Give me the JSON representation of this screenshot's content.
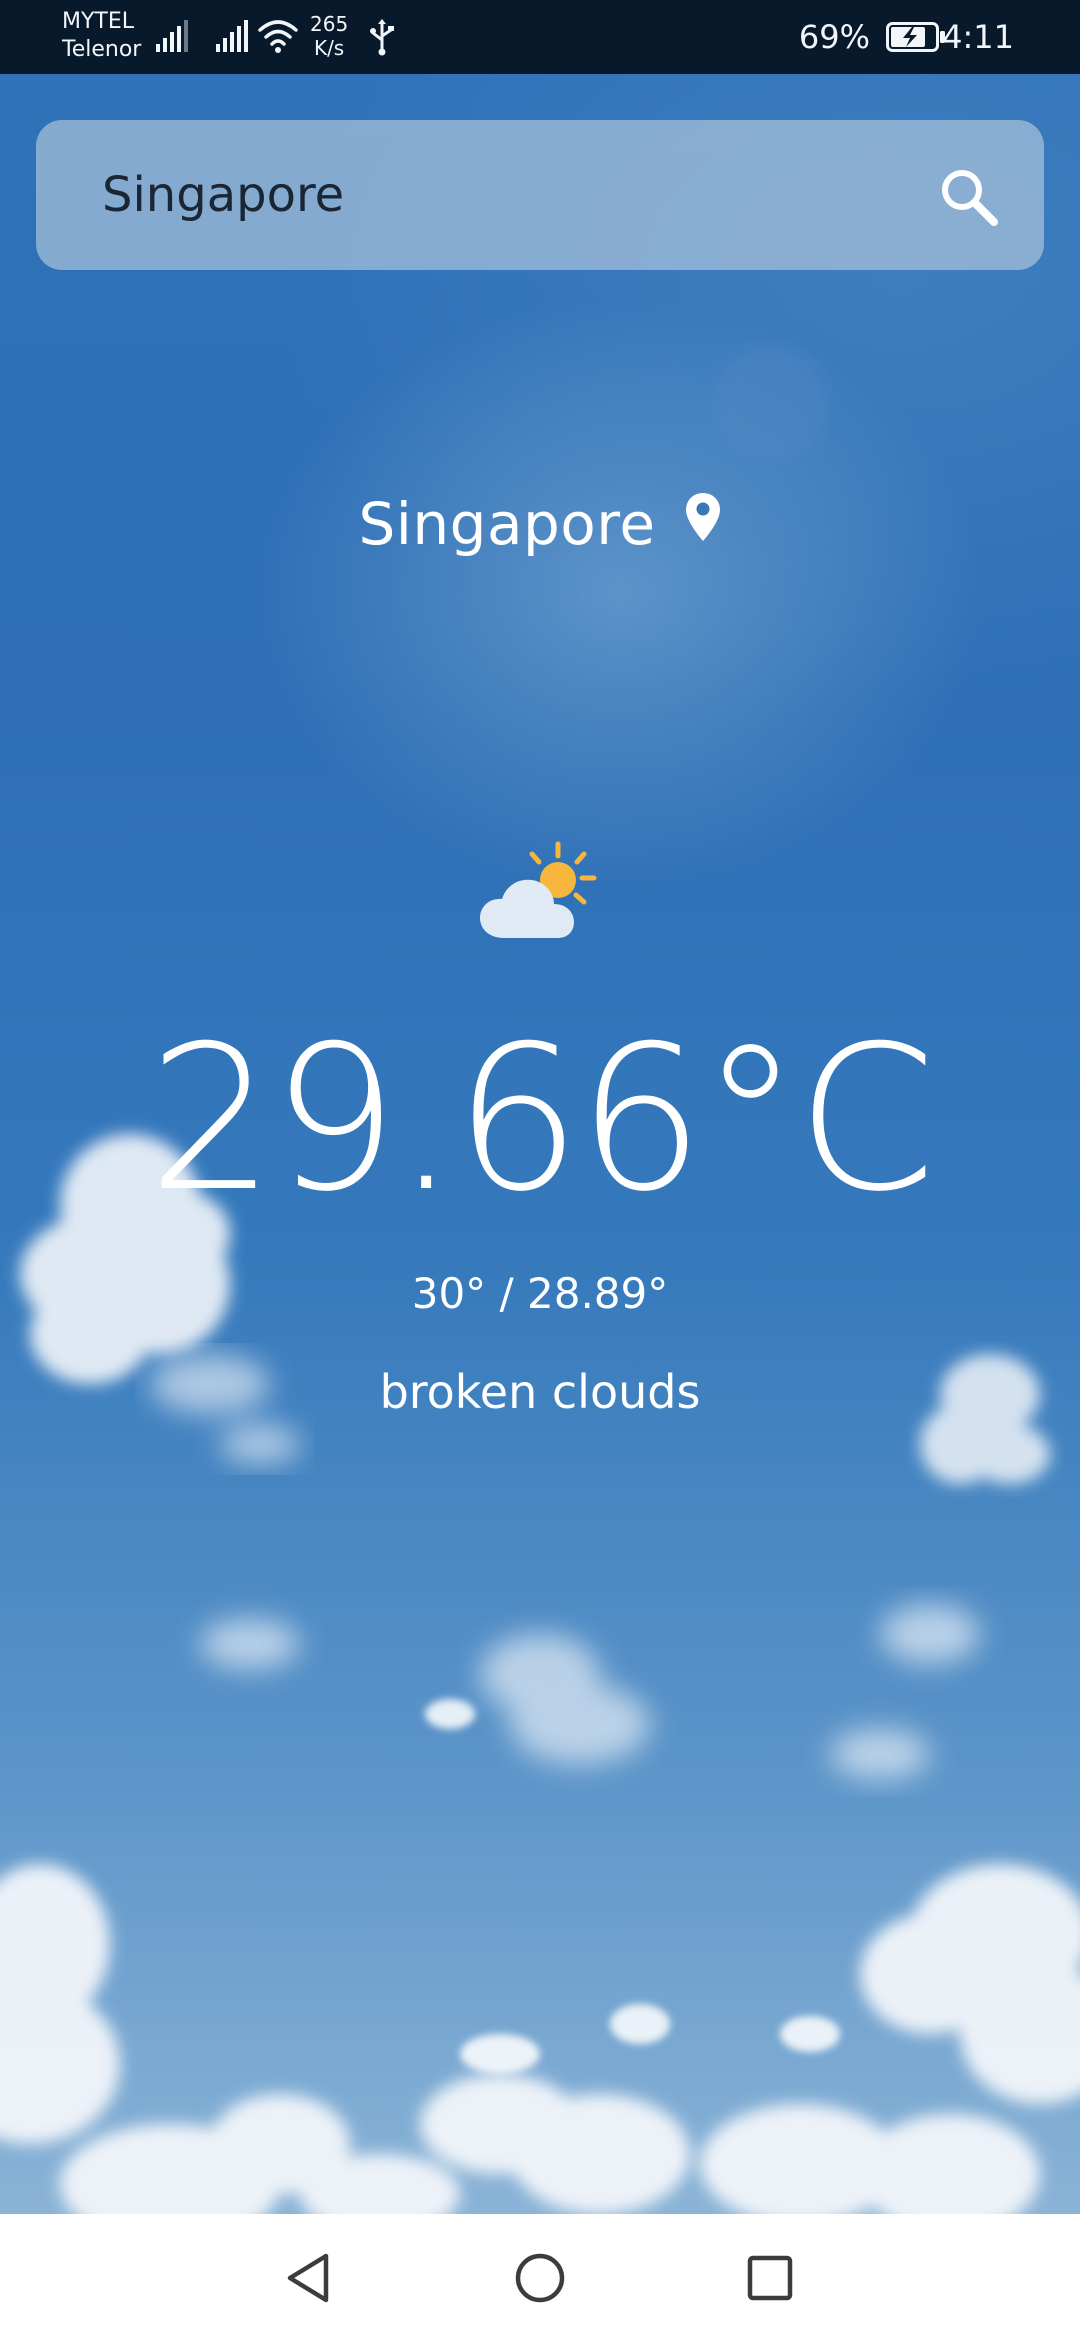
{
  "status_bar": {
    "carrier_1": "MYTEL",
    "carrier_2": "Telenor",
    "net_speed_value": "265",
    "net_speed_unit": "K/s",
    "battery_percent": "69%",
    "time": "4:11"
  },
  "search": {
    "value": "Singapore",
    "icon": "search-icon"
  },
  "weather": {
    "location": "Singapore",
    "location_icon": "map-pin-icon",
    "condition_icon": "partly-cloudy-icon",
    "temperature": "29.66°C",
    "min_max": "30° / 28.89°",
    "description": "broken clouds"
  },
  "navigation": {
    "back_icon": "back-triangle-icon",
    "home_icon": "home-circle-icon",
    "recents_icon": "recents-square-icon"
  },
  "colors": {
    "status_bar_bg": "#07192a",
    "sky_top": "#2f72b8",
    "sun": "#f6b73c",
    "cloud": "#dfeaf5",
    "nav_bar_bg": "#ffffff"
  }
}
